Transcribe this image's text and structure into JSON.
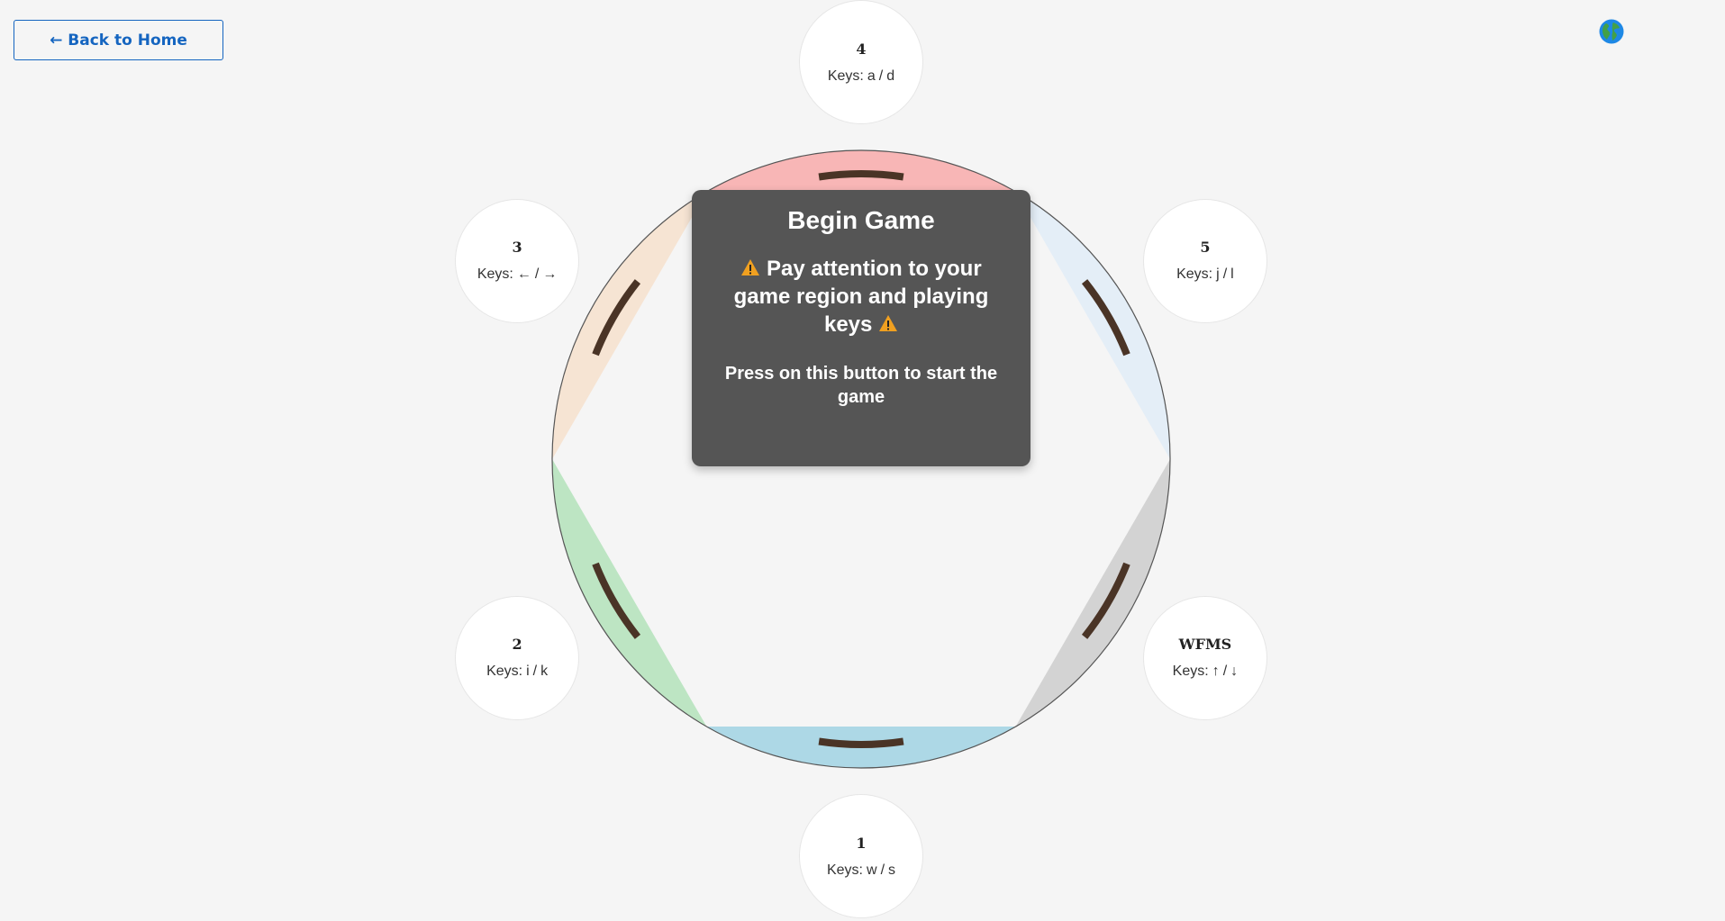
{
  "nav": {
    "back_label": "← Back to Home",
    "language_icon": "globe-icon"
  },
  "colors": {
    "background": "#f5f5f5",
    "link_blue": "#1565c0",
    "paddle": "#4a3426",
    "panel": "#555555",
    "warning": "#f0a020"
  },
  "players": [
    {
      "name": "1",
      "key_a": "w",
      "key_b": "s",
      "region_color": "#add8e6"
    },
    {
      "name": "2",
      "key_a": "i",
      "key_b": "k",
      "region_color": "#bde5c3"
    },
    {
      "name": "3",
      "key_a": "←",
      "key_b": "→",
      "region_color": "#f6e4d3"
    },
    {
      "name": "4",
      "key_a": "a",
      "key_b": "d",
      "region_color": "#f8b6b6"
    },
    {
      "name": "5",
      "key_a": "j",
      "key_b": "l",
      "region_color": "#e4eef7"
    },
    {
      "name": "WFMS",
      "key_a": "↑",
      "key_b": "↓",
      "region_color": "#d3d3d3"
    }
  ],
  "keys_prefix": "Keys:",
  "keys_separator": "/",
  "start_panel": {
    "title": "Begin Game",
    "warning": "Pay attention to your game region and playing keys",
    "instruction": "Press on this button to start the game"
  }
}
